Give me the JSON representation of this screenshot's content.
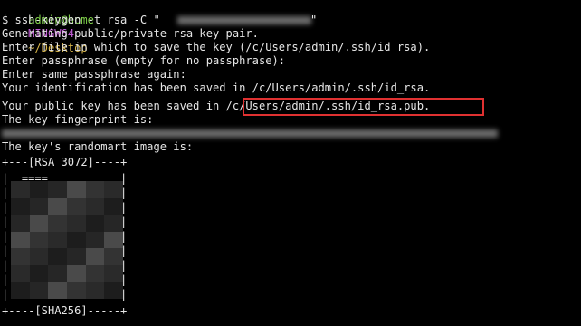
{
  "prompt": {
    "user_host": "admin@home",
    "env": "MINGW64",
    "path": "~/Desktop"
  },
  "lines": [
    "$ ssh-keygen -t rsa -C \"",
    "Generating public/private rsa key pair.",
    "Enter file in which to save the key (/c/Users/admin/.ssh/id_rsa).",
    "Enter passphrase (empty for no passphrase):",
    "Enter same passphrase again:",
    "Your identification has been saved in /c/Users/admin/.ssh/id_rsa.",
    "Your public key has been saved in /c/Users/admin/.ssh/id_rsa.pub.",
    "The key fingerprint is:",
    "",
    "The key's randomart image is:",
    "+---[RSA 3072]----+",
    "|  ====           |",
    "|                 |",
    "|                 |",
    "|                 |",
    "|                 |",
    "|                 |",
    "|                 |",
    "|                 |",
    "|                 |",
    "+----[SHA256]-----+"
  ],
  "colors": {
    "background": "#000000",
    "text": "#e6e6e6",
    "prompt_user": "#7fd04a",
    "prompt_env": "#c25ed7",
    "prompt_path": "#d8b64a",
    "highlight": "#e03131"
  }
}
